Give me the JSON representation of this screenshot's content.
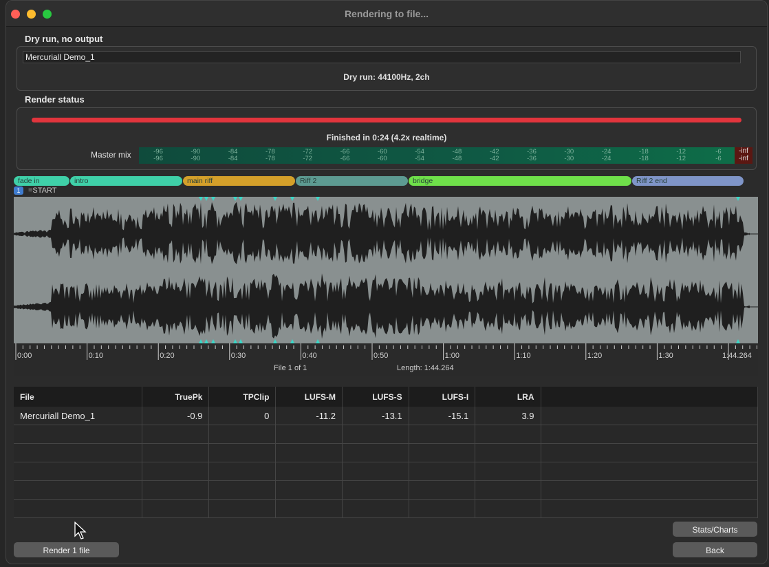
{
  "window": {
    "title": "Rendering to file..."
  },
  "output": {
    "section_label": "Dry run, no output",
    "filename": "Mercuriall Demo_1",
    "format_text": "Dry run: 44100Hz, 2ch"
  },
  "status": {
    "section_label": "Render status",
    "progress": 1.0,
    "progress_color": "#e2353d",
    "finished_text": "Finished in 0:24    (4.2x realtime)",
    "meter_label": "Master mix",
    "meter_ticks": [
      "-96",
      "-90",
      "-84",
      "-78",
      "-72",
      "-66",
      "-60",
      "-54",
      "-48",
      "-42",
      "-36",
      "-30",
      "-24",
      "-18",
      "-12",
      "-6"
    ],
    "meter_end_top": "-inf",
    "meter_end_bottom": "-inf"
  },
  "regions": [
    {
      "label": "fade in",
      "color": "#3fd0a8"
    },
    {
      "label": "intro",
      "color": "#3fd0a8"
    },
    {
      "label": "main riff",
      "color": "#d4a02a"
    },
    {
      "label": "Riff 2",
      "color": "#5d9b92"
    },
    {
      "label": "bridge",
      "color": "#6fe04a"
    },
    {
      "label": "Riff 2 end",
      "color": "#7f95c8"
    }
  ],
  "marker": {
    "number": "1",
    "label": "=START"
  },
  "timeline": {
    "labels": [
      "0:00",
      "0:10",
      "0:20",
      "0:30",
      "0:40",
      "0:50",
      "1:00",
      "1:10",
      "1:20",
      "1:30",
      "1:44.264"
    ],
    "file_info": "File 1 of 1",
    "length_info": "Length: 1:44.264"
  },
  "stats_table": {
    "columns": [
      "File",
      "TruePk",
      "TPClip",
      "LUFS-M",
      "LUFS-S",
      "LUFS-I",
      "LRA",
      ""
    ],
    "rows": [
      [
        "Mercuriall Demo_1",
        "-0.9",
        "0",
        "-11.2",
        "-13.1",
        "-15.1",
        "3.9",
        ""
      ]
    ]
  },
  "buttons": {
    "render": "Render 1 file",
    "stats": "Stats/Charts",
    "back": "Back"
  }
}
